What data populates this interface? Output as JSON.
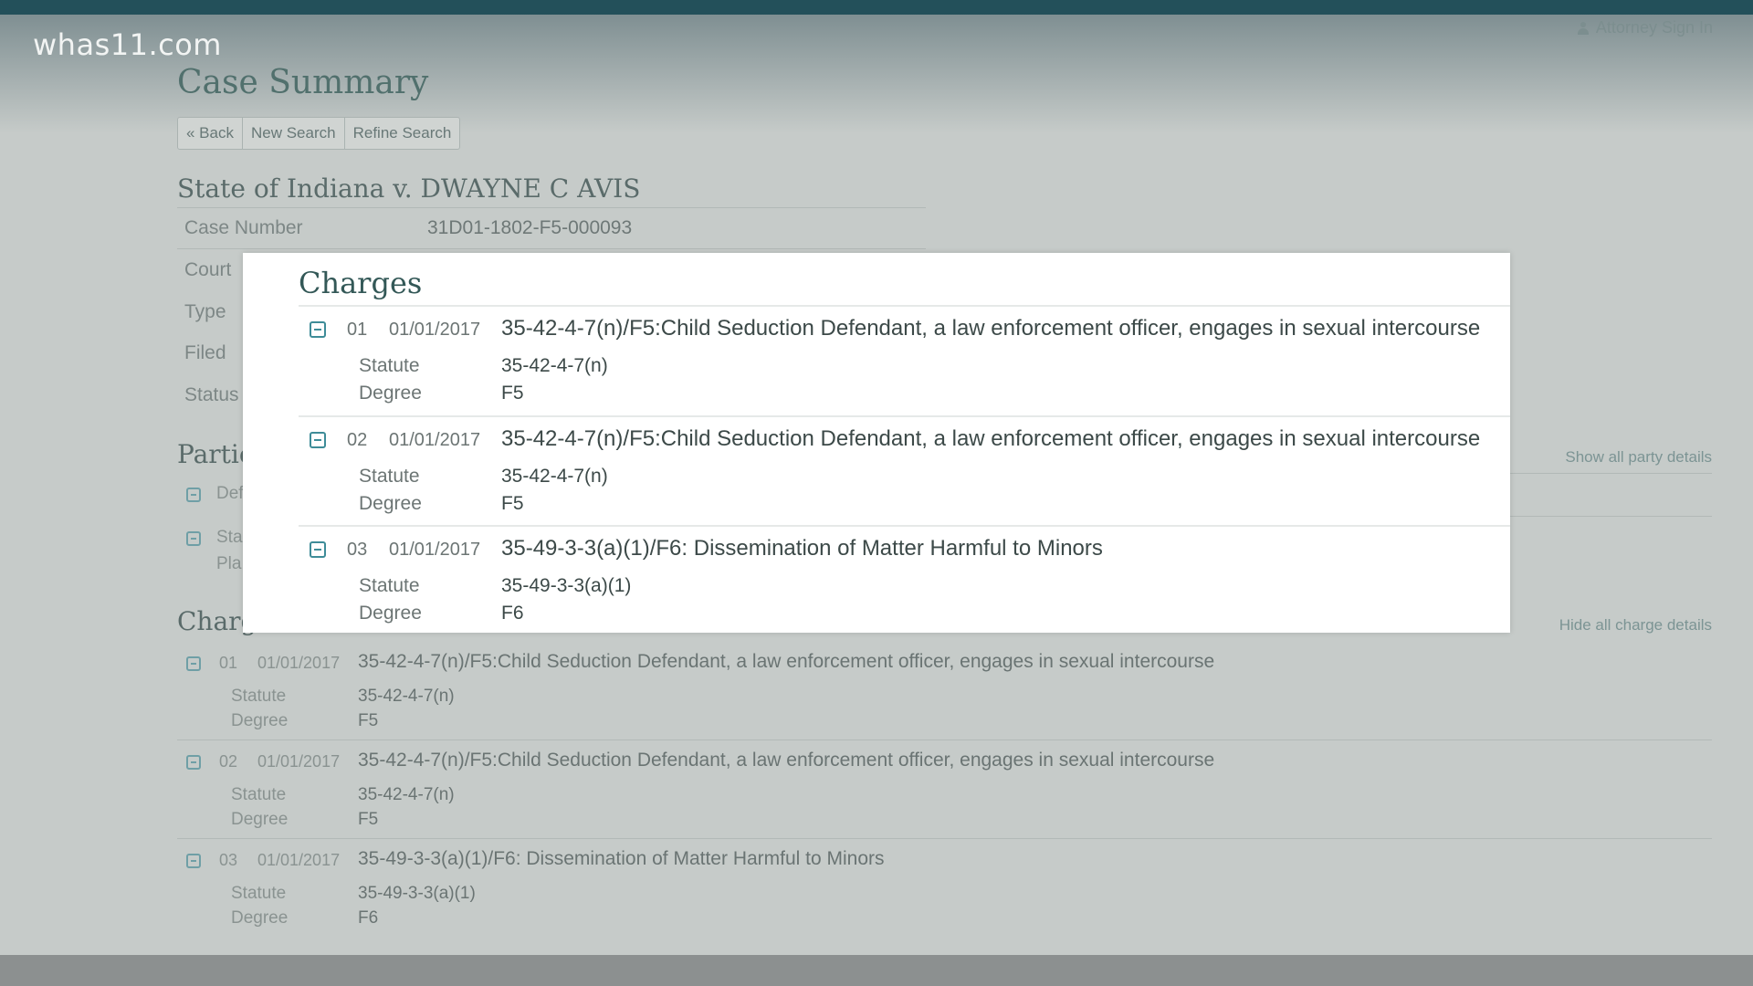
{
  "watermark": "whas11.com",
  "header": {
    "signin_label": "Attorney Sign In"
  },
  "page_title": "Case Summary",
  "nav_buttons": {
    "back": "« Back",
    "new_search": "New Search",
    "refine_search": "Refine Search"
  },
  "case": {
    "title": "State of Indiana v. DWAYNE C AVIS",
    "fields": [
      {
        "label": "Case Number",
        "value": "31D01-1802-F5-000093"
      },
      {
        "label": "Court",
        "value": ""
      },
      {
        "label": "Type",
        "value": ""
      },
      {
        "label": "Filed",
        "value": ""
      },
      {
        "label": "Status",
        "value": ""
      }
    ]
  },
  "parties": {
    "heading": "Partie",
    "show_all_label": "Show all party details",
    "items": [
      {
        "text": "Def",
        "sub": ""
      },
      {
        "text": "Sta",
        "sub": "Pla"
      }
    ]
  },
  "charges_bg": {
    "heading": "Charg",
    "hide_all_label": "Hide all charge details"
  },
  "charges_overlay_title": "Charges",
  "charges": [
    {
      "num": "01",
      "date": "01/01/2017",
      "description": "35-42-4-7(n)/F5:Child Seduction Defendant, a law enforcement officer, engages in sexual intercourse",
      "statute_label": "Statute",
      "statute": "35-42-4-7(n)",
      "degree_label": "Degree",
      "degree": "F5"
    },
    {
      "num": "02",
      "date": "01/01/2017",
      "description": "35-42-4-7(n)/F5:Child Seduction Defendant, a law enforcement officer, engages in sexual intercourse",
      "statute_label": "Statute",
      "statute": "35-42-4-7(n)",
      "degree_label": "Degree",
      "degree": "F5"
    },
    {
      "num": "03",
      "date": "01/01/2017",
      "description": "35-49-3-3(a)(1)/F6: Dissemination of Matter Harmful to Minors",
      "statute_label": "Statute",
      "statute": "35-49-3-3(a)(1)",
      "degree_label": "Degree",
      "degree": "F6"
    }
  ]
}
